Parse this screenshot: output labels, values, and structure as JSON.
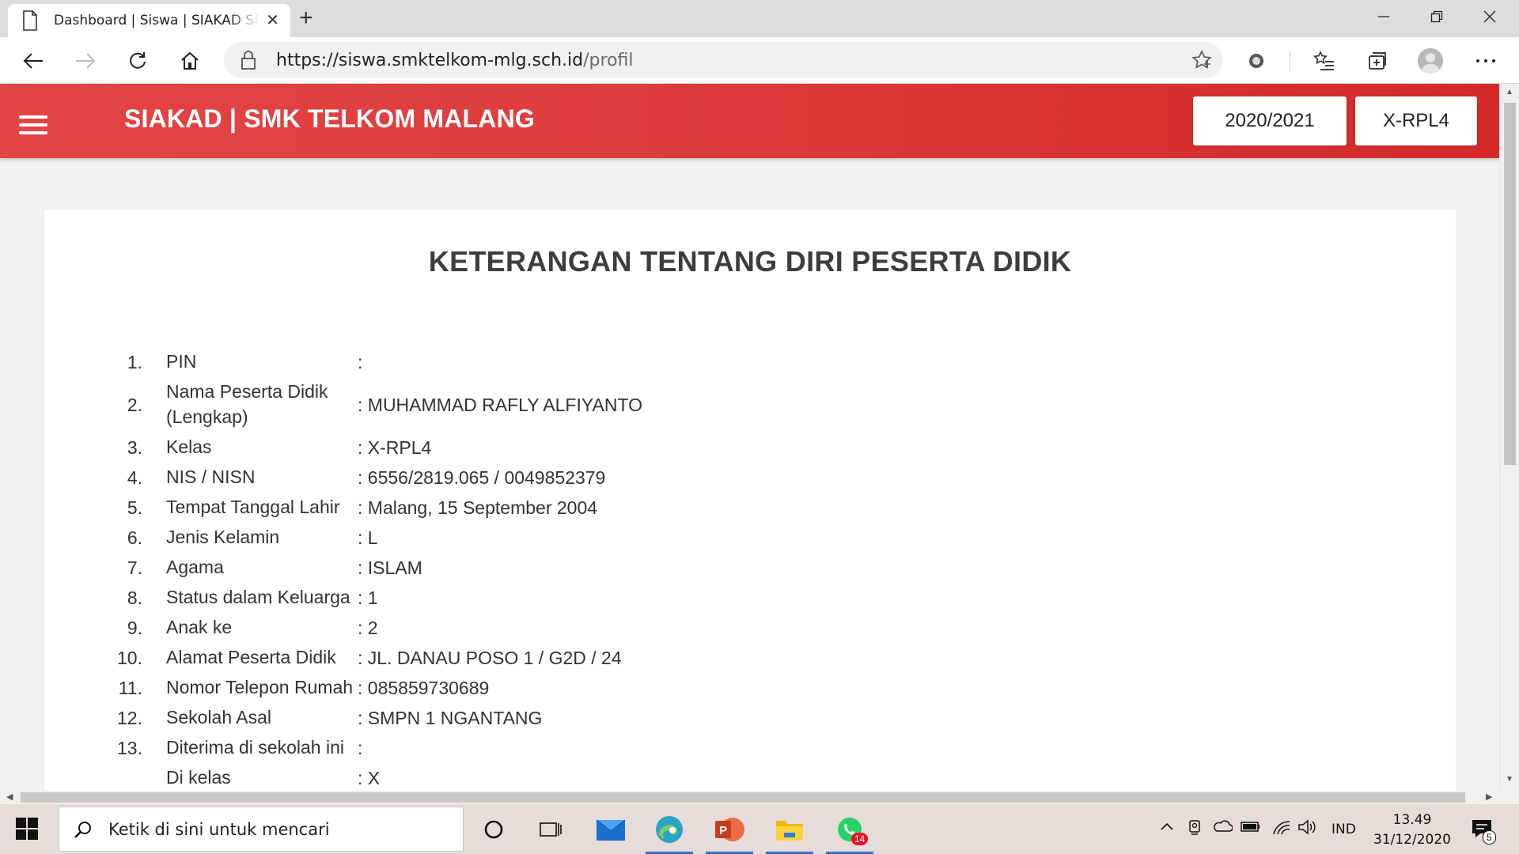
{
  "browser": {
    "tab_title": "Dashboard | Siswa | SIAKAD SMK TELKOM MALANG",
    "url_host": "https://siswa.smktelkom-mlg.sch.id",
    "url_path": "/profil",
    "new_tab_symbol": "+",
    "window_controls": [
      "minimize-icon",
      "restore-icon",
      "close-icon"
    ]
  },
  "app": {
    "brand": "SIAKAD | SMK TELKOM MALANG",
    "year_button": "2020/2021",
    "class_button": "X-RPL4",
    "accent_color": "#dc3a3a"
  },
  "page": {
    "title": "KETERANGAN TENTANG DIRI PESERTA DIDIK",
    "fields": [
      {
        "num": "1.",
        "label": "PIN",
        "value": ":"
      },
      {
        "num": "2.",
        "label": "Nama Peserta Didik (Lengkap)",
        "value": ": MUHAMMAD RAFLY ALFIYANTO"
      },
      {
        "num": "3.",
        "label": "Kelas",
        "value": ": X-RPL4"
      },
      {
        "num": "4.",
        "label": "NIS / NISN",
        "value": ": 6556/2819.065 / 0049852379"
      },
      {
        "num": "5.",
        "label": "Tempat Tanggal Lahir",
        "value": ": Malang, 15 September 2004"
      },
      {
        "num": "6.",
        "label": "Jenis Kelamin",
        "value": ": L"
      },
      {
        "num": "7.",
        "label": "Agama",
        "value": ": ISLAM"
      },
      {
        "num": "8.",
        "label": "Status dalam Keluarga",
        "value": ": 1"
      },
      {
        "num": "9.",
        "label": "Anak ke",
        "value": ": 2"
      },
      {
        "num": "10.",
        "label": "Alamat Peserta Didik",
        "value": ": JL. DANAU POSO 1 / G2D / 24"
      },
      {
        "num": "11.",
        "label": "Nomor Telepon Rumah",
        "value": ": 085859730689"
      },
      {
        "num": "12.",
        "label": "Sekolah Asal",
        "value": ": SMPN 1 NGANTANG"
      },
      {
        "num": "13.",
        "label": "Diterima di sekolah ini",
        "value": ":"
      },
      {
        "num": "",
        "label": "Di kelas",
        "value": ": X"
      }
    ]
  },
  "taskbar": {
    "search_placeholder": "Ketik di sini untuk mencari",
    "whatsapp_badge": "14",
    "language": "IND",
    "time": "13.49",
    "date": "31/12/2020",
    "notification_count": "5"
  }
}
